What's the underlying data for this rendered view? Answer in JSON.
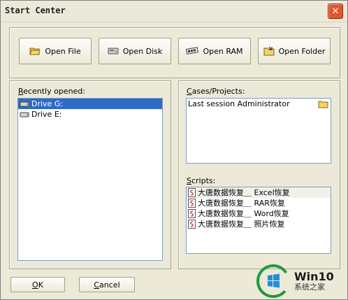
{
  "window": {
    "title": "Start Center",
    "close_glyph": "✕"
  },
  "toolbar": {
    "buttons": [
      {
        "label": "Open File",
        "icon": "open-folder-icon"
      },
      {
        "label": "Open Disk",
        "icon": "disk-icon"
      },
      {
        "label": "Open RAM",
        "icon": "ram-icon"
      },
      {
        "label": "Open Folder",
        "icon": "folder-icon"
      }
    ]
  },
  "recent": {
    "label": "Recently opened:",
    "items": [
      {
        "label": "Drive G:",
        "selected": true,
        "icon": "drive-icon"
      },
      {
        "label": "Drive E:",
        "selected": false,
        "icon": "drive-icon"
      }
    ]
  },
  "cases": {
    "label": "Cases/Projects:",
    "items": [
      {
        "label": "Last session Administrator",
        "icon": "folder-icon"
      }
    ]
  },
  "scripts": {
    "label": "Scripts:",
    "items": [
      {
        "label": "大唐数据恢复＿ Excel恢复",
        "icon": "script-icon"
      },
      {
        "label": "大唐数据恢复＿ RAR恢复",
        "icon": "script-icon"
      },
      {
        "label": "大唐数据恢复＿ Word恢复",
        "icon": "script-icon"
      },
      {
        "label": "大唐数据恢复＿ 照片恢复",
        "icon": "script-icon"
      }
    ]
  },
  "footer": {
    "ok_label": "OK",
    "cancel_label": "Cancel"
  },
  "watermark": {
    "title": "Win10",
    "subtitle": "系统之家"
  },
  "colors": {
    "selection": "#316ac5",
    "window_bg": "#ece9d8",
    "close_button": "#e0572f"
  }
}
